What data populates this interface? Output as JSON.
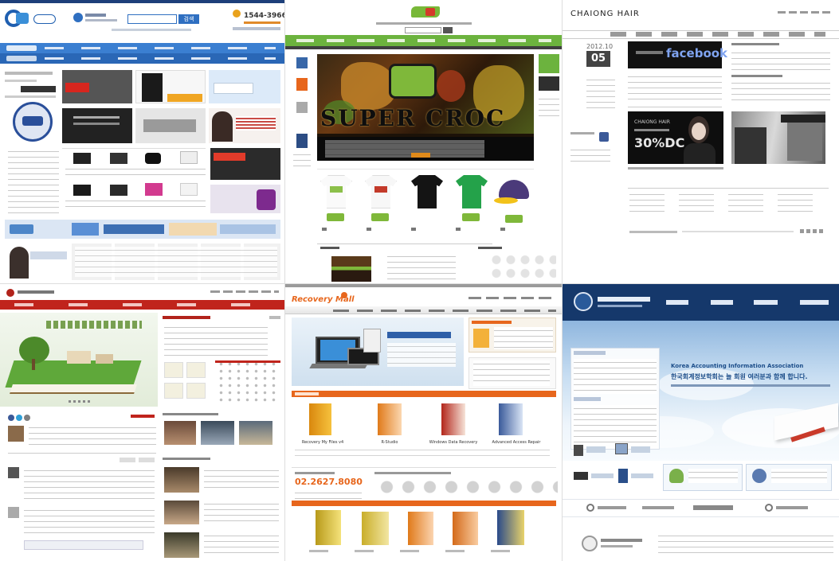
{
  "t1": {
    "phone": "1544-3966",
    "search_btn": "검색",
    "nav1": [
      "",
      "",
      "",
      "",
      "",
      "",
      ""
    ],
    "nav2": [
      "",
      "",
      "",
      "",
      "",
      "",
      ""
    ]
  },
  "t2": {
    "banner_text": "SUPER CROC"
  },
  "t3": {
    "logo": "CHAIONG HAIR",
    "date_top": "2012.10",
    "date_big": "05",
    "facebook": "facebook",
    "promo_brand": "CHAIONG HAIR",
    "promo_discount": "30%DC"
  },
  "t4": {
    "nav": [
      "",
      "",
      "",
      "",
      ""
    ]
  },
  "t5": {
    "logo": "Recovery Mall",
    "phone": "02.2627.8080",
    "products": [
      "Recovery My Files v4",
      "R-Studio",
      "Windows Data Recovery",
      "Advanced Access Repair"
    ]
  },
  "t6": {
    "nav": [
      "",
      "",
      "",
      ""
    ],
    "hero_en": "Korea Accounting Information Association",
    "hero_ko": "한국회계정보학회는 늘 회원 여러분과 함께 합니다."
  },
  "colors": {
    "t1_blue": "#2f6fc1",
    "t2_green": "#6cb33e",
    "t4_red": "#c0241c",
    "t5_orange": "#e7661c",
    "t6_navy": "#15386b"
  }
}
